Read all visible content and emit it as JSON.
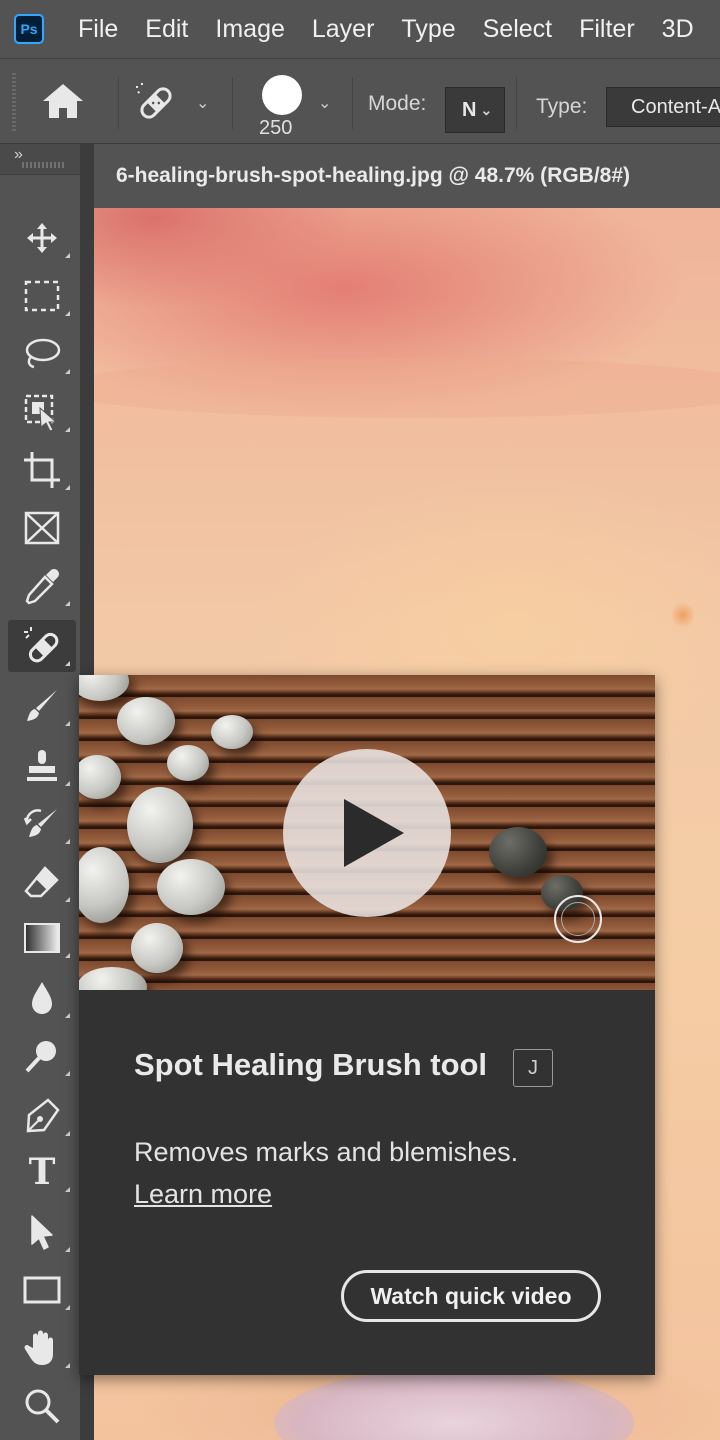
{
  "app": {
    "logo_text": "Ps",
    "icon": "photoshop-logo"
  },
  "menubar": {
    "items": [
      "File",
      "Edit",
      "Image",
      "Layer",
      "Type",
      "Select",
      "Filter",
      "3D"
    ]
  },
  "options": {
    "home_icon": "home-icon",
    "tool_preset_icon": "spot-healing-brush-icon",
    "brush_size": "250",
    "mode_label": "Mode:",
    "mode_value": "N",
    "type_label": "Type:",
    "type_value": "Content-A"
  },
  "toolbar": {
    "collapse": "»",
    "tools": [
      {
        "name": "move-tool",
        "icon": "move-icon"
      },
      {
        "name": "marquee-tool",
        "icon": "rectangular-marquee-icon"
      },
      {
        "name": "lasso-tool",
        "icon": "lasso-icon"
      },
      {
        "name": "object-selection-tool",
        "icon": "object-selection-icon"
      },
      {
        "name": "crop-tool",
        "icon": "crop-icon"
      },
      {
        "name": "frame-tool",
        "icon": "frame-icon"
      },
      {
        "name": "eyedropper-tool",
        "icon": "eyedropper-icon"
      },
      {
        "name": "spot-healing-brush-tool",
        "icon": "spot-healing-brush-icon",
        "active": true
      },
      {
        "name": "brush-tool",
        "icon": "brush-icon"
      },
      {
        "name": "clone-stamp-tool",
        "icon": "stamp-icon"
      },
      {
        "name": "history-brush-tool",
        "icon": "history-brush-icon"
      },
      {
        "name": "eraser-tool",
        "icon": "eraser-icon"
      },
      {
        "name": "gradient-tool",
        "icon": "gradient-icon"
      },
      {
        "name": "blur-tool",
        "icon": "blur-drop-icon"
      },
      {
        "name": "dodge-tool",
        "icon": "dodge-icon"
      },
      {
        "name": "pen-tool",
        "icon": "pen-icon"
      },
      {
        "name": "type-tool",
        "icon": "type-icon",
        "glyph": "T"
      },
      {
        "name": "path-selection-tool",
        "icon": "arrow-pointer-icon"
      },
      {
        "name": "rectangle-tool",
        "icon": "rectangle-icon"
      },
      {
        "name": "hand-tool",
        "icon": "hand-icon"
      },
      {
        "name": "zoom-tool",
        "icon": "zoom-icon"
      }
    ]
  },
  "document": {
    "tab_title": "6-healing-brush-spot-healing.jpg @ 48.7% (RGB/8#)"
  },
  "rich_tooltip": {
    "title": "Spot Healing Brush tool",
    "shortcut": "J",
    "description": "Removes marks and blemishes.",
    "learn_more": "Learn more",
    "watch_button": "Watch quick video",
    "play_icon": "play-icon"
  }
}
